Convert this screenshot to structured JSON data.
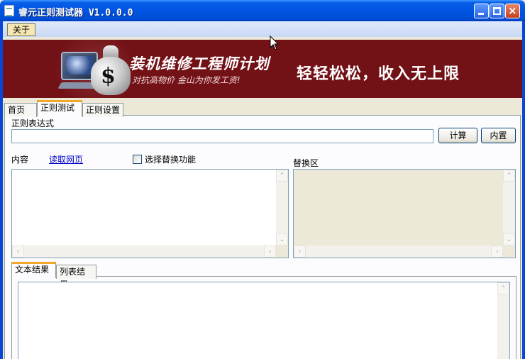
{
  "window": {
    "title": "睿元正则测试器 V1.0.0.0",
    "controls": {
      "minimize": "",
      "maximize": "",
      "close": "×"
    }
  },
  "menu": {
    "about": "关于"
  },
  "banner": {
    "title": "装机维修工程师计划",
    "subtitle": "对抗高物价 金山为你发工资!",
    "slogan": "轻轻松松，收入无上限",
    "icon": "dollar-sign",
    "dollar": "$"
  },
  "tabs": [
    "首页",
    "正则测试",
    "正则设置"
  ],
  "active_tab": "正则测试",
  "regex": {
    "label": "正则表达式",
    "value": "",
    "calc_button": "计算",
    "builtin_button": "内置"
  },
  "content": {
    "label": "内容",
    "read_webpage_link": "读取网页",
    "replace_checkbox_label": "选择替换功能",
    "replace_checked": false,
    "replace_area_label": "替换区",
    "content_text": "",
    "replace_text": ""
  },
  "result_tabs": [
    "文本结果",
    "列表结果"
  ],
  "active_result_tab": "文本结果",
  "result_text": "",
  "scroll_glyphs": {
    "up": "⌃",
    "down": "⌄",
    "left": "‹",
    "right": "›"
  },
  "colors": {
    "banner_bg": "#731216",
    "titlebar": "#0054e3",
    "tab_accent": "#f4a62a"
  }
}
